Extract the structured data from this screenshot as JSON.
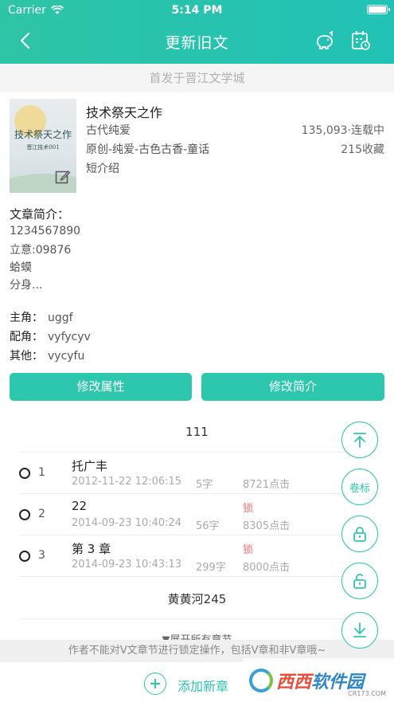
{
  "status_bar": {
    "carrier": "Carrier",
    "time": "5:14 PM"
  },
  "nav": {
    "title": "更新旧文"
  },
  "origin_text": "首发于晋江文学城",
  "cover": {
    "title": "技术祭天之作",
    "subtitle": "晋江技术001"
  },
  "book": {
    "title": "技术祭天之作",
    "genre": "古代纯爱",
    "tags": "原创-纯爱-古色古香-童话",
    "short_intro": "短介绍",
    "count_status": "135,093·连载中",
    "favorites": "215收藏"
  },
  "intro": {
    "label": "文章简介：",
    "lines": [
      "1234567890",
      "立意:09876",
      "蛤蟆",
      "分身..."
    ]
  },
  "roles": [
    {
      "label": "主角：",
      "value": "uggf"
    },
    {
      "label": "配角：",
      "value": "vyfycyv"
    },
    {
      "label": "其他：",
      "value": "vycyfu"
    }
  ],
  "buttons": {
    "edit_attr": "修改属性",
    "edit_intro": "修改简介"
  },
  "volumes": [
    "111",
    "黄黄河245"
  ],
  "chapters": [
    {
      "num": "1",
      "title": "托广丰",
      "date": "2012-11-22 12:06:15",
      "words": "5字",
      "lock": "",
      "clicks": "8721点击"
    },
    {
      "num": "2",
      "title": "22",
      "date": "2014-09-23 10:40:24",
      "words": "56字",
      "lock": "锁",
      "clicks": "8305点击"
    },
    {
      "num": "3",
      "title": "第 3 章",
      "date": "2014-09-23 10:43:13",
      "words": "299字",
      "lock": "锁",
      "clicks": "8000点击"
    }
  ],
  "expand_text": "▼展开所有章节",
  "notice": "作者不能对V文章节进行锁定操作，包括V章和非V章哦~",
  "add_text": "添加新章",
  "fab": {
    "volume_label": "卷标"
  },
  "watermark": {
    "text_a": "西西",
    "text_b": "软件园",
    "sub": "CR173.COM"
  },
  "colors": {
    "accent": "#2cc7ad",
    "lock": "#f07070"
  }
}
